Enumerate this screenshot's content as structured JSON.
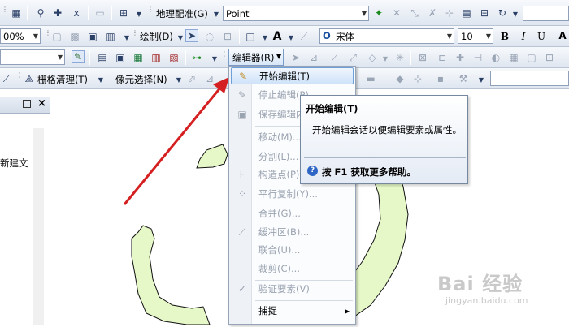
{
  "toolbar1": {
    "georef_label": "地理配准(G)",
    "layer_combo": "Point",
    "scale_field": ""
  },
  "toolbar2": {
    "zoom_combo": "00%",
    "draw_label": "绘制(D)",
    "font_name": "宋体",
    "font_size": "10",
    "bold": "B",
    "italic": "I",
    "underline": "U",
    "text_tool": "A"
  },
  "toolbar3": {
    "layer_combo": "",
    "editor_label": "编辑器(R)"
  },
  "toolbar4": {
    "raster_cleanup_label": "栅格清理(T)",
    "pixel_select_label": "像元选择(N)"
  },
  "toc": {
    "item_label": "新建文"
  },
  "editor_menu": {
    "items": [
      {
        "label": "开始编辑(T)",
        "enabled": true,
        "icon": "pencil-icon"
      },
      {
        "label": "停止编辑(P)",
        "enabled": false,
        "icon": "stop-edit-icon"
      },
      {
        "label": "保存编辑内容(S)",
        "enabled": false,
        "icon": "save-icon"
      },
      {
        "label": "移动(M)...",
        "enabled": false,
        "icon": ""
      },
      {
        "label": "分割(L)...",
        "enabled": false,
        "icon": ""
      },
      {
        "label": "构造点(P)...",
        "enabled": false,
        "icon": "construct-points-icon"
      },
      {
        "label": "平行复制(Y)...",
        "enabled": false,
        "icon": "copy-parallel-icon"
      },
      {
        "label": "合并(G)...",
        "enabled": false,
        "icon": ""
      },
      {
        "label": "缓冲区(B)...",
        "enabled": false,
        "icon": "buffer-icon"
      },
      {
        "label": "联合(U)...",
        "enabled": false,
        "icon": ""
      },
      {
        "label": "裁剪(C)...",
        "enabled": false,
        "icon": ""
      },
      {
        "label": "验证要素(V)",
        "enabled": false,
        "icon": "validate-icon"
      },
      {
        "label": "捕捉",
        "enabled": true,
        "icon": ""
      }
    ]
  },
  "tooltip": {
    "title": "开始编辑(T)",
    "body": "开始编辑会话以便编辑要素或属性。",
    "help": "按 F1 获取更多帮助。"
  },
  "watermark": {
    "big": "Bai 经验",
    "small": "jingyan.baidu.com"
  },
  "colors": {
    "polygon_fill": "#e6f8c8",
    "arrow": "#d42020",
    "menu_highlight": "#cfe3f9"
  }
}
